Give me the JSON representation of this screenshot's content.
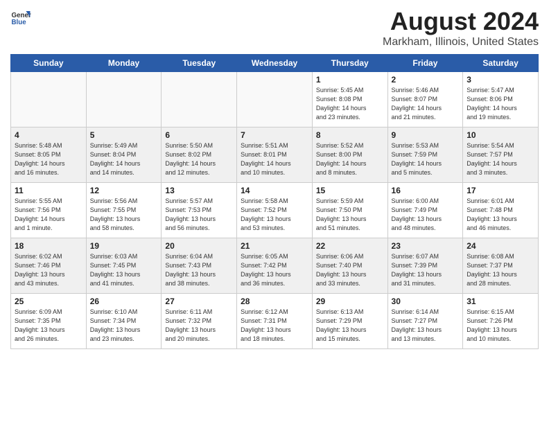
{
  "header": {
    "logo_general": "General",
    "logo_blue": "Blue",
    "month_title": "August 2024",
    "location": "Markham, Illinois, United States"
  },
  "days_of_week": [
    "Sunday",
    "Monday",
    "Tuesday",
    "Wednesday",
    "Thursday",
    "Friday",
    "Saturday"
  ],
  "weeks": [
    [
      {
        "num": "",
        "info": ""
      },
      {
        "num": "",
        "info": ""
      },
      {
        "num": "",
        "info": ""
      },
      {
        "num": "",
        "info": ""
      },
      {
        "num": "1",
        "info": "Sunrise: 5:45 AM\nSunset: 8:08 PM\nDaylight: 14 hours\nand 23 minutes."
      },
      {
        "num": "2",
        "info": "Sunrise: 5:46 AM\nSunset: 8:07 PM\nDaylight: 14 hours\nand 21 minutes."
      },
      {
        "num": "3",
        "info": "Sunrise: 5:47 AM\nSunset: 8:06 PM\nDaylight: 14 hours\nand 19 minutes."
      }
    ],
    [
      {
        "num": "4",
        "info": "Sunrise: 5:48 AM\nSunset: 8:05 PM\nDaylight: 14 hours\nand 16 minutes."
      },
      {
        "num": "5",
        "info": "Sunrise: 5:49 AM\nSunset: 8:04 PM\nDaylight: 14 hours\nand 14 minutes."
      },
      {
        "num": "6",
        "info": "Sunrise: 5:50 AM\nSunset: 8:02 PM\nDaylight: 14 hours\nand 12 minutes."
      },
      {
        "num": "7",
        "info": "Sunrise: 5:51 AM\nSunset: 8:01 PM\nDaylight: 14 hours\nand 10 minutes."
      },
      {
        "num": "8",
        "info": "Sunrise: 5:52 AM\nSunset: 8:00 PM\nDaylight: 14 hours\nand 8 minutes."
      },
      {
        "num": "9",
        "info": "Sunrise: 5:53 AM\nSunset: 7:59 PM\nDaylight: 14 hours\nand 5 minutes."
      },
      {
        "num": "10",
        "info": "Sunrise: 5:54 AM\nSunset: 7:57 PM\nDaylight: 14 hours\nand 3 minutes."
      }
    ],
    [
      {
        "num": "11",
        "info": "Sunrise: 5:55 AM\nSunset: 7:56 PM\nDaylight: 14 hours\nand 1 minute."
      },
      {
        "num": "12",
        "info": "Sunrise: 5:56 AM\nSunset: 7:55 PM\nDaylight: 13 hours\nand 58 minutes."
      },
      {
        "num": "13",
        "info": "Sunrise: 5:57 AM\nSunset: 7:53 PM\nDaylight: 13 hours\nand 56 minutes."
      },
      {
        "num": "14",
        "info": "Sunrise: 5:58 AM\nSunset: 7:52 PM\nDaylight: 13 hours\nand 53 minutes."
      },
      {
        "num": "15",
        "info": "Sunrise: 5:59 AM\nSunset: 7:50 PM\nDaylight: 13 hours\nand 51 minutes."
      },
      {
        "num": "16",
        "info": "Sunrise: 6:00 AM\nSunset: 7:49 PM\nDaylight: 13 hours\nand 48 minutes."
      },
      {
        "num": "17",
        "info": "Sunrise: 6:01 AM\nSunset: 7:48 PM\nDaylight: 13 hours\nand 46 minutes."
      }
    ],
    [
      {
        "num": "18",
        "info": "Sunrise: 6:02 AM\nSunset: 7:46 PM\nDaylight: 13 hours\nand 43 minutes."
      },
      {
        "num": "19",
        "info": "Sunrise: 6:03 AM\nSunset: 7:45 PM\nDaylight: 13 hours\nand 41 minutes."
      },
      {
        "num": "20",
        "info": "Sunrise: 6:04 AM\nSunset: 7:43 PM\nDaylight: 13 hours\nand 38 minutes."
      },
      {
        "num": "21",
        "info": "Sunrise: 6:05 AM\nSunset: 7:42 PM\nDaylight: 13 hours\nand 36 minutes."
      },
      {
        "num": "22",
        "info": "Sunrise: 6:06 AM\nSunset: 7:40 PM\nDaylight: 13 hours\nand 33 minutes."
      },
      {
        "num": "23",
        "info": "Sunrise: 6:07 AM\nSunset: 7:39 PM\nDaylight: 13 hours\nand 31 minutes."
      },
      {
        "num": "24",
        "info": "Sunrise: 6:08 AM\nSunset: 7:37 PM\nDaylight: 13 hours\nand 28 minutes."
      }
    ],
    [
      {
        "num": "25",
        "info": "Sunrise: 6:09 AM\nSunset: 7:35 PM\nDaylight: 13 hours\nand 26 minutes."
      },
      {
        "num": "26",
        "info": "Sunrise: 6:10 AM\nSunset: 7:34 PM\nDaylight: 13 hours\nand 23 minutes."
      },
      {
        "num": "27",
        "info": "Sunrise: 6:11 AM\nSunset: 7:32 PM\nDaylight: 13 hours\nand 20 minutes."
      },
      {
        "num": "28",
        "info": "Sunrise: 6:12 AM\nSunset: 7:31 PM\nDaylight: 13 hours\nand 18 minutes."
      },
      {
        "num": "29",
        "info": "Sunrise: 6:13 AM\nSunset: 7:29 PM\nDaylight: 13 hours\nand 15 minutes."
      },
      {
        "num": "30",
        "info": "Sunrise: 6:14 AM\nSunset: 7:27 PM\nDaylight: 13 hours\nand 13 minutes."
      },
      {
        "num": "31",
        "info": "Sunrise: 6:15 AM\nSunset: 7:26 PM\nDaylight: 13 hours\nand 10 minutes."
      }
    ]
  ]
}
